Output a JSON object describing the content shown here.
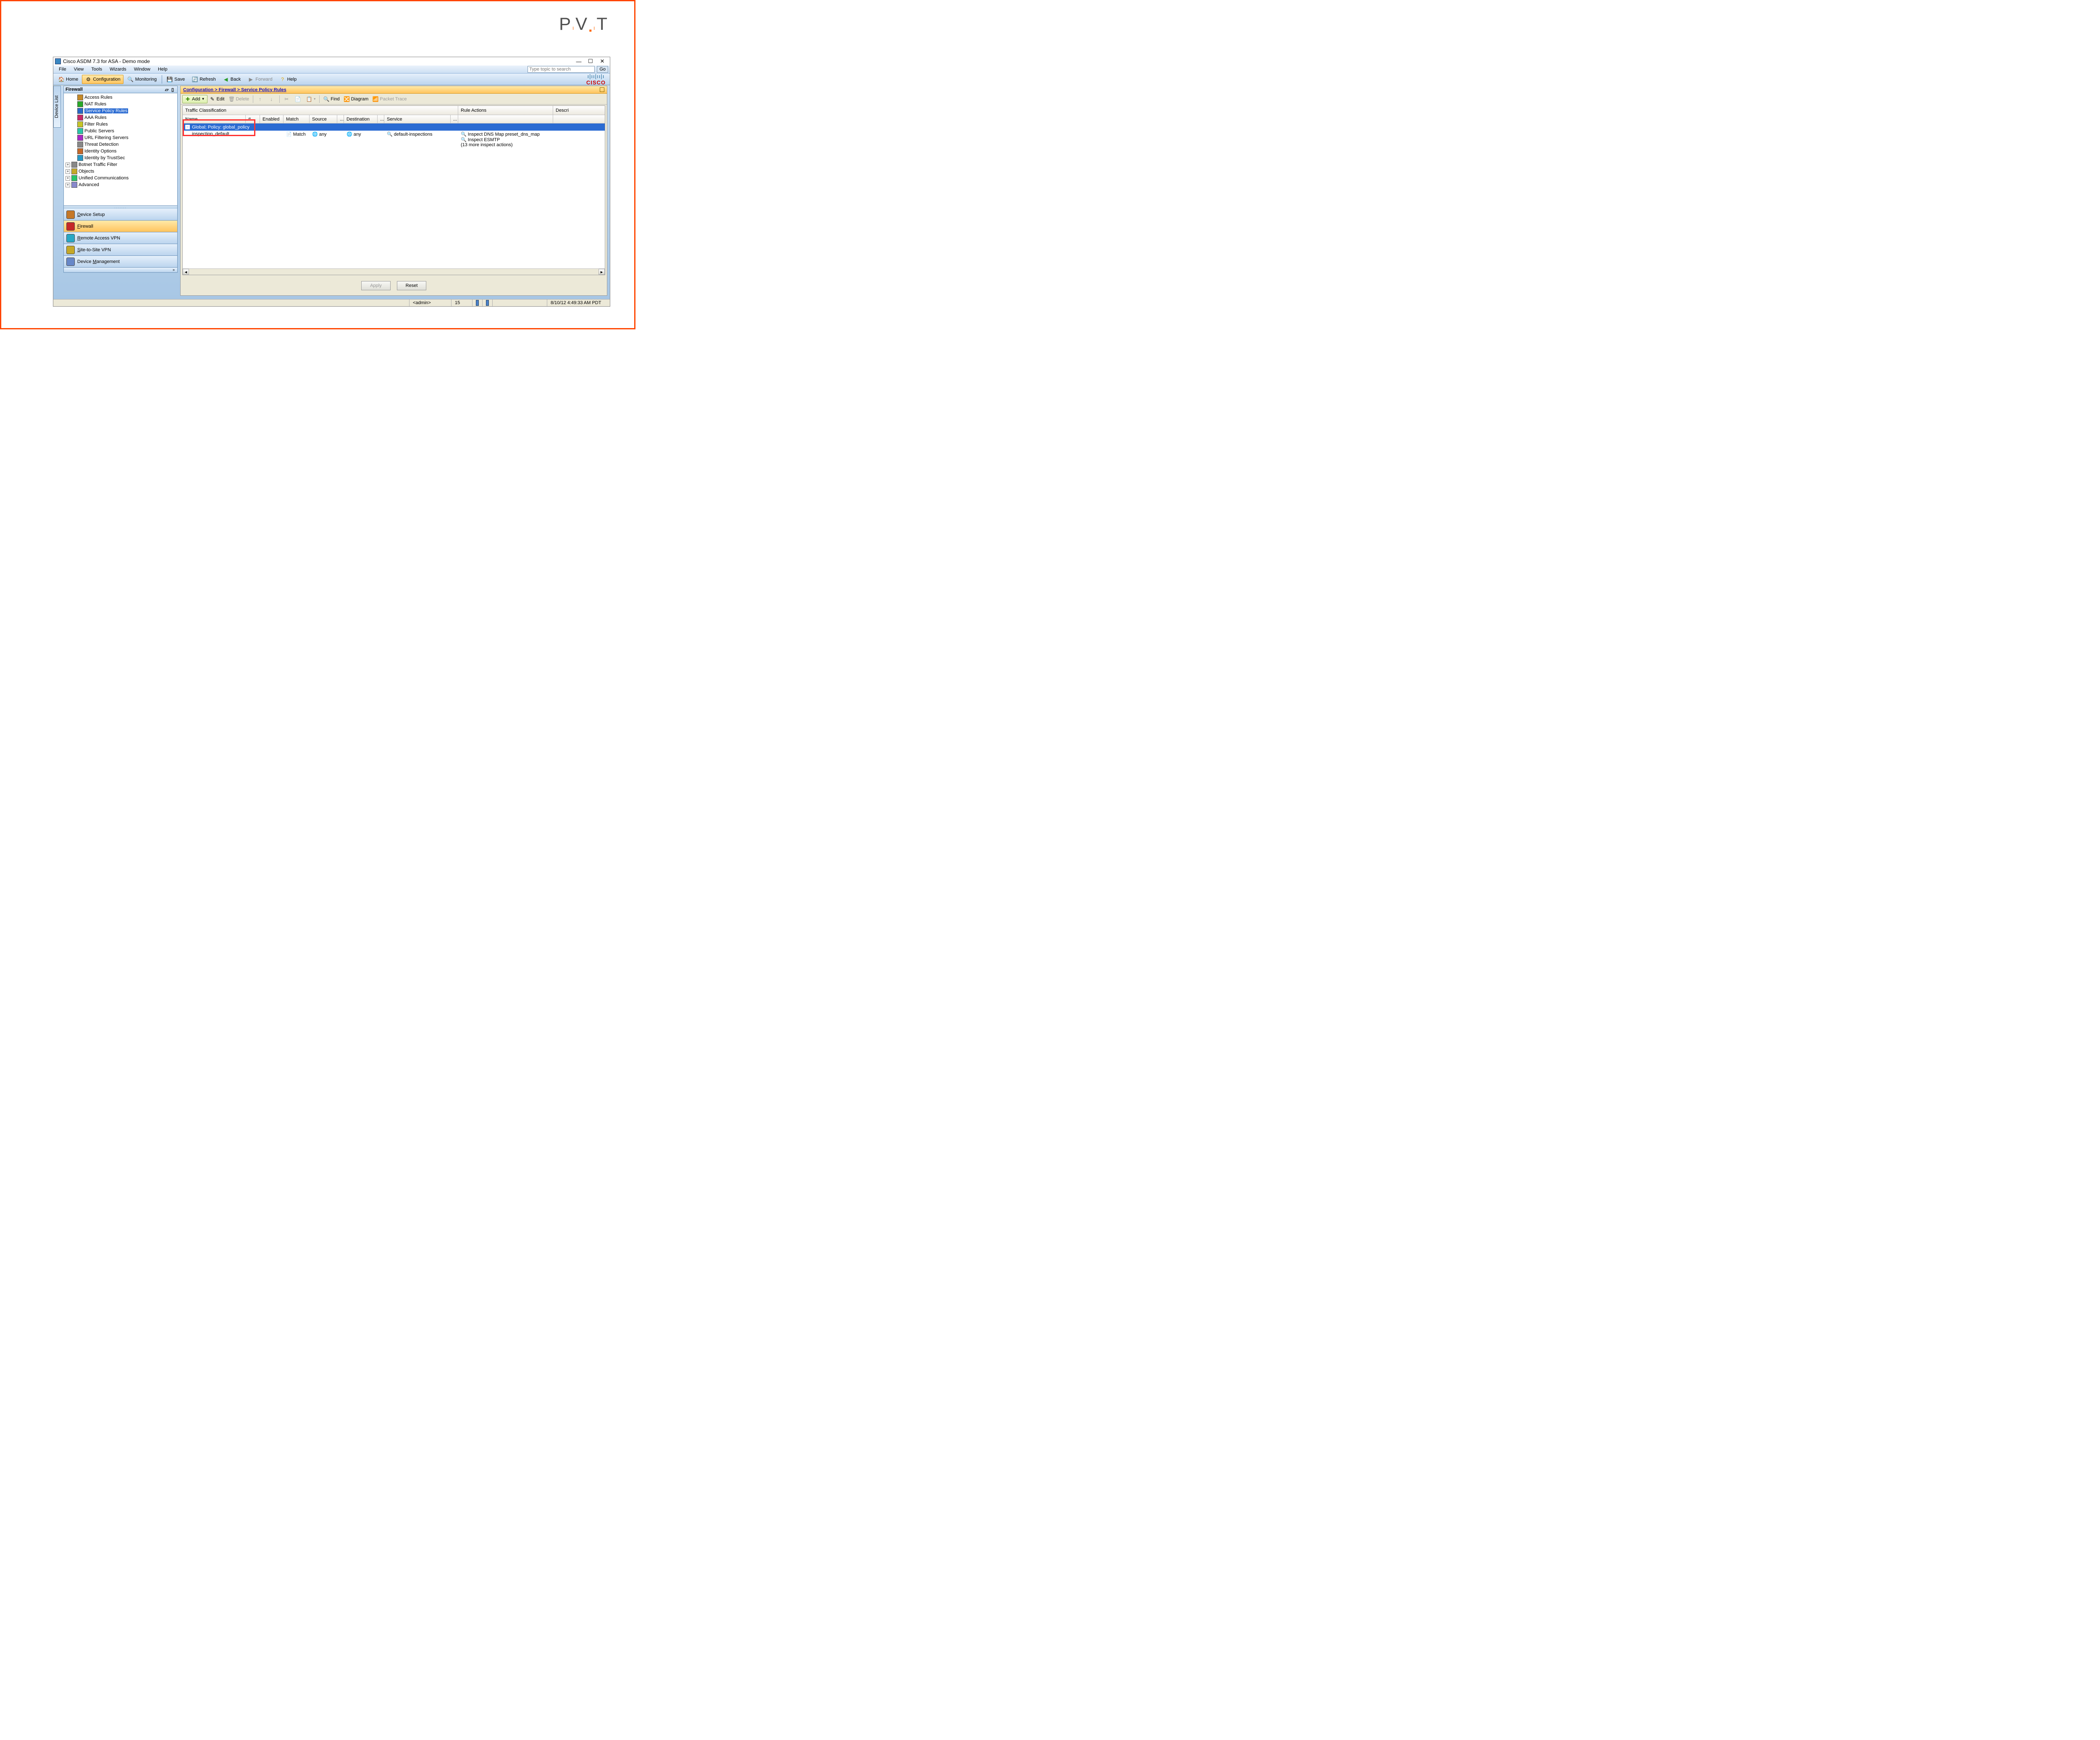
{
  "brand": "PIVIT",
  "window": {
    "title": "Cisco ASDM 7.3 for ASA - Demo mode",
    "min": "—",
    "max": "☐",
    "close": "✕"
  },
  "menu": {
    "items": [
      "File",
      "View",
      "Tools",
      "Wizards",
      "Window",
      "Help"
    ],
    "search_placeholder": "Type topic to search",
    "go": "Go"
  },
  "cisco": {
    "text": "CISCO"
  },
  "toolbar": {
    "home": "Home",
    "configuration": "Configuration",
    "monitoring": "Monitoring",
    "save": "Save",
    "refresh": "Refresh",
    "back": "Back",
    "forward": "Forward",
    "help": "Help"
  },
  "device_list_tab": "Device List",
  "left": {
    "panel_title": "Firewall",
    "tree": [
      {
        "label": "Access Rules",
        "indent": 1
      },
      {
        "label": "NAT Rules",
        "indent": 1
      },
      {
        "label": "Service Policy Rules",
        "indent": 1,
        "selected": true
      },
      {
        "label": "AAA Rules",
        "indent": 1
      },
      {
        "label": "Filter Rules",
        "indent": 1
      },
      {
        "label": "Public Servers",
        "indent": 1
      },
      {
        "label": "URL Filtering Servers",
        "indent": 1
      },
      {
        "label": "Threat Detection",
        "indent": 1
      },
      {
        "label": "Identity Options",
        "indent": 1
      },
      {
        "label": "Identity by TrustSec",
        "indent": 1
      },
      {
        "label": "Botnet Traffic Filter",
        "indent": 0,
        "expander": "+"
      },
      {
        "label": "Objects",
        "indent": 0,
        "expander": "+"
      },
      {
        "label": "Unified Communications",
        "indent": 0,
        "expander": "+"
      },
      {
        "label": "Advanced",
        "indent": 0,
        "expander": "+"
      }
    ],
    "nav": [
      {
        "label": "Device Setup",
        "accel": "D"
      },
      {
        "label": "Firewall",
        "accel": "F",
        "selected": true
      },
      {
        "label": "Remote Access VPN",
        "accel": "R"
      },
      {
        "label": "Site-to-Site VPN",
        "accel": "S"
      },
      {
        "label": "Device Management",
        "accel": "M"
      }
    ],
    "expand": "»"
  },
  "main": {
    "breadcrumb": "Configuration > Firewall > Service Policy Rules",
    "tb": {
      "add": "Add",
      "edit": "Edit",
      "delete": "Delete",
      "find": "Find",
      "diagram": "Diagram",
      "packet_trace": "Packet Trace"
    },
    "grid": {
      "group_head": "Traffic Classification",
      "rule_actions": "Rule Actions",
      "descri": "Descri",
      "cols": {
        "name": "Name",
        "num": "#",
        "enabled": "Enabled",
        "match": "Match",
        "source": "Source",
        "dots1": "...",
        "destination": "Destination",
        "dots2": "...",
        "service": "Service",
        "dots3": "..."
      },
      "group_row": "Global; Policy: global_policy",
      "row": {
        "name": "inspection_default",
        "match": "Match",
        "source": "any",
        "destination": "any",
        "service": "default-inspections",
        "actions": [
          "Inspect DNS Map preset_dns_map",
          "Inspect ESMTP",
          "(13 more inspect actions)"
        ]
      }
    },
    "buttons": {
      "apply": "Apply",
      "reset": "Reset"
    }
  },
  "status": {
    "user": "<admin>",
    "num": "15",
    "time": "8/10/12 4:49:33 AM PDT"
  }
}
